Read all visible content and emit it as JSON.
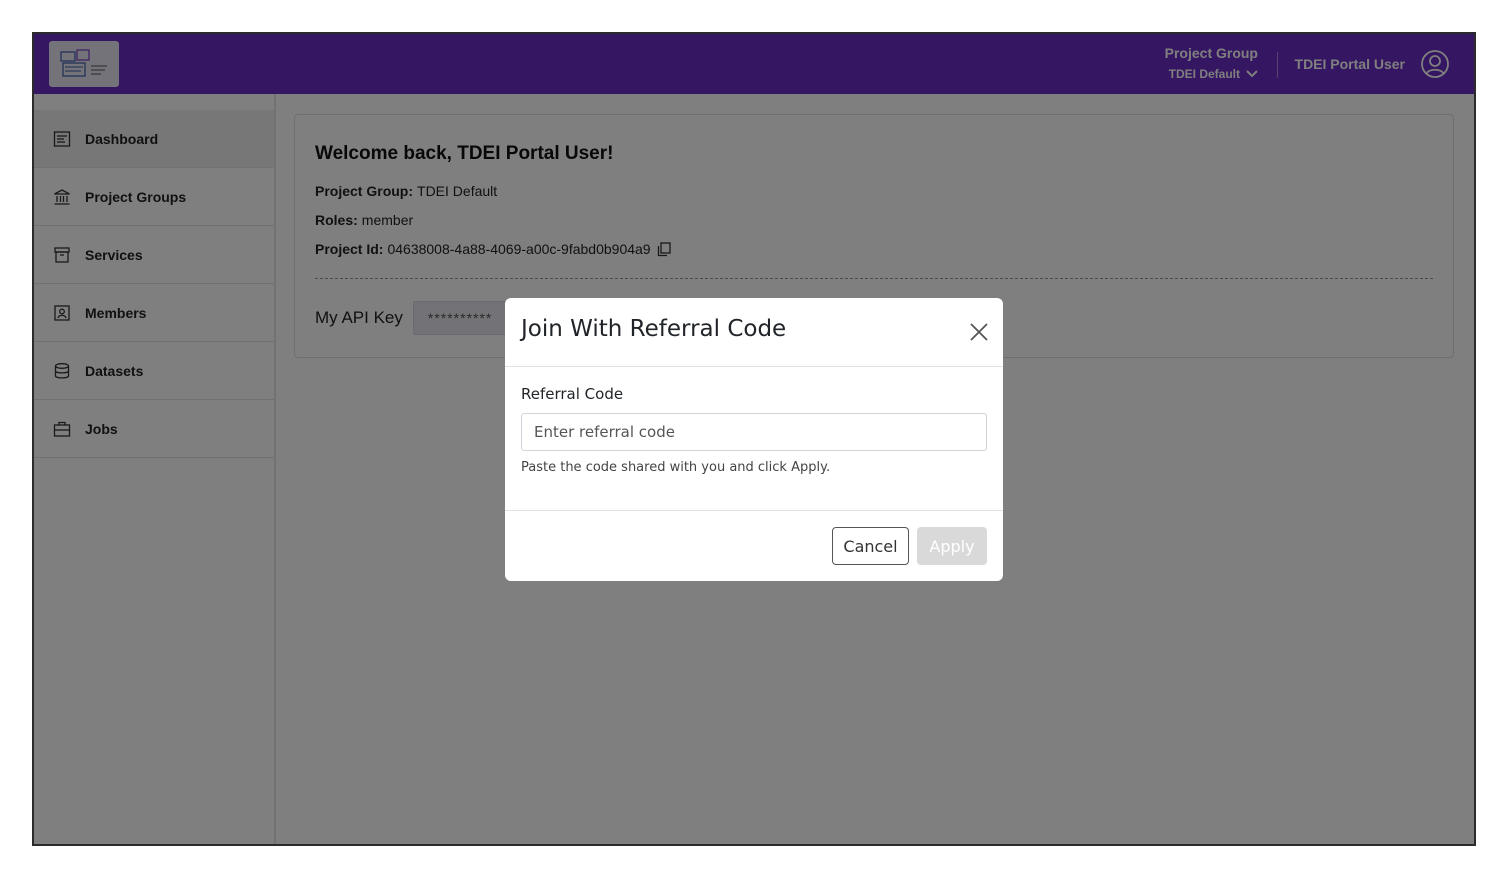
{
  "header": {
    "project_group_label": "Project Group",
    "project_group_value": "TDEI Default",
    "user_name": "TDEI Portal User",
    "accent_color": "#6a2cc4"
  },
  "sidebar": {
    "items": [
      {
        "label": "Dashboard",
        "icon": "dashboard-icon",
        "active": true
      },
      {
        "label": "Project Groups",
        "icon": "bank-icon",
        "active": false
      },
      {
        "label": "Services",
        "icon": "archive-icon",
        "active": false
      },
      {
        "label": "Members",
        "icon": "member-badge-icon",
        "active": false
      },
      {
        "label": "Datasets",
        "icon": "database-icon",
        "active": false
      },
      {
        "label": "Jobs",
        "icon": "briefcase-icon",
        "active": false
      }
    ]
  },
  "main": {
    "welcome_title": "Welcome back, TDEI Portal User!",
    "project_group_key": "Project Group:",
    "project_group_value": "TDEI Default",
    "roles_key": "Roles:",
    "roles_value": "member",
    "project_id_key": "Project Id:",
    "project_id_value": "04638008-4a88-4069-a00c-9fabd0b904a9",
    "api_key_label": "My API Key",
    "api_key_value": "**********"
  },
  "modal": {
    "title": "Join With Referral Code",
    "field_label": "Referral Code",
    "placeholder": "Enter referral code",
    "input_value": "",
    "help_text": "Paste the code shared with you and click Apply.",
    "cancel_label": "Cancel",
    "apply_label": "Apply"
  }
}
